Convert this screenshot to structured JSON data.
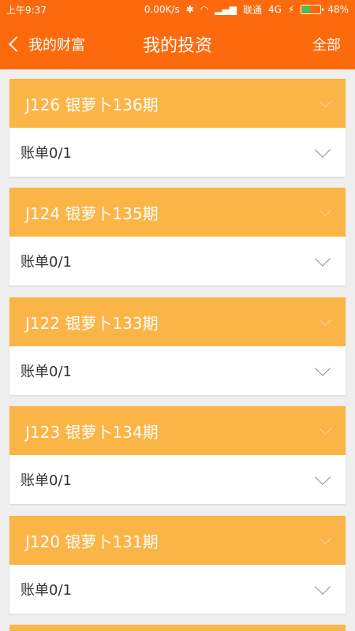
{
  "statusbar": {
    "time": "上午9:37",
    "speed": "0.00K/s",
    "carrier": "联通",
    "network": "4G",
    "battery": "48%",
    "battery_level": 0.48
  },
  "navbar": {
    "back_label": "我的财富",
    "title": "我的投资",
    "right_label": "全部"
  },
  "cards": [
    {
      "title": "J126 银萝卜136期",
      "bill": "账单0/1"
    },
    {
      "title": "J124 银萝卜135期",
      "bill": "账单0/1"
    },
    {
      "title": "J122 银萝卜133期",
      "bill": "账单0/1"
    },
    {
      "title": "J123 银萝卜134期",
      "bill": "账单0/1"
    },
    {
      "title": "J120 银萝卜131期",
      "bill": "账单0/1"
    }
  ]
}
